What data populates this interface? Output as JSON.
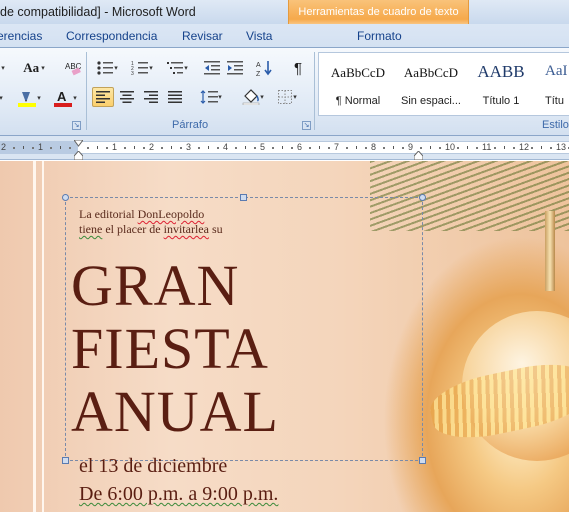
{
  "titlebar": {
    "doc_title": "de compatibilidad] - Microsoft Word",
    "context_group": "Herramientas de cuadro de texto"
  },
  "tabs": [
    {
      "label": "erencias"
    },
    {
      "label": "Correspondencia"
    },
    {
      "label": "Revisar"
    },
    {
      "label": "Vista"
    },
    {
      "label": "Formato"
    }
  ],
  "ribbon": {
    "font_group": {
      "change_case": "Aa",
      "clear_format": "ABC",
      "highlight_color": "#ffff00",
      "font_color": "#d81e1e"
    },
    "paragraph_group": {
      "label": "Párrafo",
      "pilcrow": "¶"
    },
    "styles_group": {
      "label": "Estilo",
      "items": [
        {
          "sample": "AaBbCcD",
          "name": "¶ Normal"
        },
        {
          "sample": "AaBbCcD",
          "name": "Sin espaci..."
        },
        {
          "sample": "AABB",
          "name": "Título 1"
        },
        {
          "sample": "AaI",
          "name": "Títu"
        }
      ]
    }
  },
  "ruler": {
    "numbers": [
      "2",
      "1",
      "1",
      "2",
      "3",
      "4",
      "5",
      "6",
      "7",
      "8",
      "9",
      "10",
      "11",
      "12",
      "13"
    ]
  },
  "document": {
    "intro_line1": {
      "a": "La editorial ",
      "b": "DonLeopoldo"
    },
    "intro_line2": {
      "a": "tiene",
      "b": " el placer de ",
      "c": "invitarlea",
      "d": " su"
    },
    "headline": [
      "GRAN",
      "FIESTA",
      "ANUAL"
    ],
    "date_line": "el 13 de diciembre",
    "time_line": "De 6:00 p.m. a 9:00 p.m."
  }
}
